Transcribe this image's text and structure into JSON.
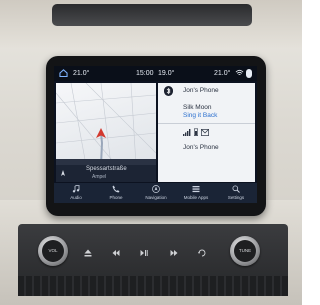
{
  "status_bar": {
    "temp_left": "21.0°",
    "clock": "15:00",
    "temp_mid": "19.0°",
    "temp_right": "21.0°"
  },
  "map": {
    "street_name": "Spessartstraße",
    "street_sub": "Ampel"
  },
  "media": {
    "phone_name_1": "Jon's Phone",
    "song_title": "Silk Moon",
    "artist": "Sing it Back",
    "phone_name_2": "Jon's Phone"
  },
  "nav_bar": {
    "items": [
      {
        "label": "Audio",
        "icon": "music-note-icon"
      },
      {
        "label": "Phone",
        "icon": "phone-icon"
      },
      {
        "label": "Navigation",
        "icon": "navigation-icon"
      },
      {
        "label": "Mobile Apps",
        "icon": "apps-icon"
      },
      {
        "label": "Settings",
        "icon": "settings-icon"
      }
    ]
  },
  "controls": {
    "vol_label": "VOL",
    "tune_label": "TUNE"
  },
  "colors": {
    "accent_blue": "#2a6fcf",
    "nav_bg": "#1a2436",
    "nav_arrow": "#d2382e"
  }
}
